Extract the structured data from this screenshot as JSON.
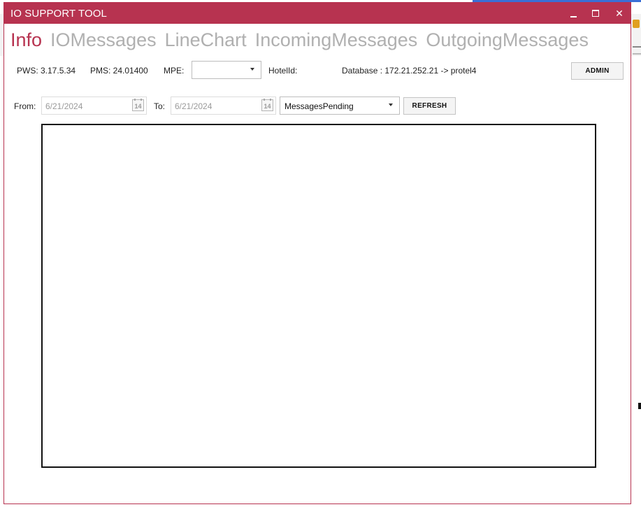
{
  "window": {
    "title": "IO SUPPORT TOOL",
    "minimize_label": "",
    "maximize_label": "",
    "close_label": "✕"
  },
  "tabs": [
    {
      "label": "Info",
      "active": true
    },
    {
      "label": "IOMessages",
      "active": false
    },
    {
      "label": "LineChart",
      "active": false
    },
    {
      "label": "IncomingMessages",
      "active": false
    },
    {
      "label": "OutgoingMessages",
      "active": false
    }
  ],
  "info": {
    "pws": "PWS: 3.17.5.34",
    "pms": "PMS: 24.01400",
    "mpe_label": "MPE:",
    "mpe_value": "",
    "hotelid_label": "HotelId:",
    "database": "Database : 172.21.252.21 -> protel4",
    "admin_button": "ADMIN"
  },
  "filter": {
    "from_label": "From:",
    "from_value": "6/21/2024",
    "to_label": "To:",
    "to_value": "6/21/2024",
    "calendar_day": "14",
    "metric_value": "MessagesPending",
    "refresh_button": "REFRESH"
  },
  "colors": {
    "accent": "#b73350",
    "inactive_tab": "#b0b0b0"
  }
}
